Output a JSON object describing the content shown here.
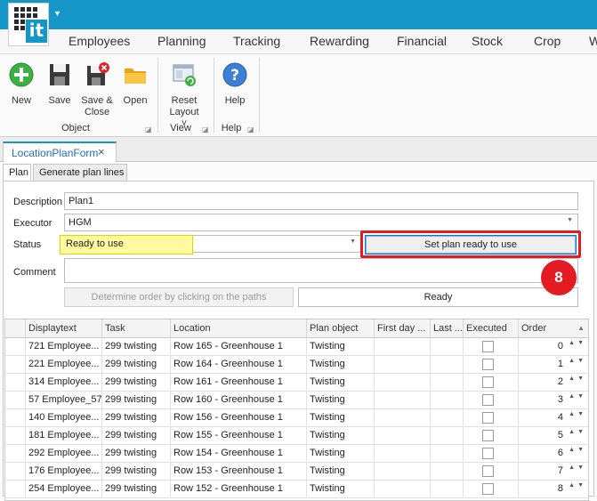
{
  "app": {
    "logo_text": "it",
    "quick_access_icon": "dropdown-arrow-icon",
    "brand_color": "#1496c8"
  },
  "menu": [
    "Employees",
    "Planning",
    "Tracking",
    "Rewarding",
    "Financial",
    "Stock",
    "Crop",
    "W"
  ],
  "ribbon": {
    "groups": [
      {
        "label": "Object",
        "buttons": [
          {
            "label": "New",
            "icon": "add-icon"
          },
          {
            "label": "Save",
            "icon": "save-icon"
          },
          {
            "label": "Save & Close",
            "icon": "save-close-icon"
          },
          {
            "label": "Open",
            "icon": "folder-icon"
          }
        ]
      },
      {
        "label": "View",
        "buttons": [
          {
            "label": "Reset Layout ˅",
            "icon": "reset-layout-icon"
          }
        ]
      },
      {
        "label": "Help",
        "buttons": [
          {
            "label": "Help",
            "icon": "help-icon"
          }
        ]
      }
    ]
  },
  "document_tab": {
    "label": "LocationPlanForm",
    "close": "×"
  },
  "subtabs": [
    "Plan",
    "Generate plan lines"
  ],
  "form": {
    "description_label": "Description",
    "description_value": "Plan1",
    "executor_label": "Executor",
    "executor_value": "HGM",
    "status_label": "Status",
    "status_value": "Ready to use",
    "comment_label": "Comment",
    "comment_value": "",
    "set_ready_button": "Set plan ready to use",
    "determine_order_button": "Determine order by clicking on the paths",
    "ready_button": "Ready",
    "step_badge": "8",
    "highlight_color": "#e31b23",
    "status_highlight_color": "#fff9a0"
  },
  "grid": {
    "columns": [
      "Displaytext",
      "Task",
      "Location",
      "Plan object",
      "First day ...",
      "Last ...",
      "Executed",
      "Order"
    ],
    "rows": [
      {
        "displaytext": "721 Employee...",
        "task": "299 twisting",
        "location": "Row 165 - Greenhouse 1",
        "plan_object": "Twisting",
        "first_day": "",
        "last": "",
        "executed": false,
        "order": "0"
      },
      {
        "displaytext": "221 Employee...",
        "task": "299 twisting",
        "location": "Row 164 - Greenhouse 1",
        "plan_object": "Twisting",
        "first_day": "",
        "last": "",
        "executed": false,
        "order": "1"
      },
      {
        "displaytext": "314 Employee...",
        "task": "299 twisting",
        "location": "Row 161 - Greenhouse 1",
        "plan_object": "Twisting",
        "first_day": "",
        "last": "",
        "executed": false,
        "order": "2"
      },
      {
        "displaytext": "57 Employee_57",
        "task": "299 twisting",
        "location": "Row 160 - Greenhouse 1",
        "plan_object": "Twisting",
        "first_day": "",
        "last": "",
        "executed": false,
        "order": "3"
      },
      {
        "displaytext": "140 Employee...",
        "task": "299 twisting",
        "location": "Row 156 - Greenhouse 1",
        "plan_object": "Twisting",
        "first_day": "",
        "last": "",
        "executed": false,
        "order": "4"
      },
      {
        "displaytext": "181 Employee...",
        "task": "299 twisting",
        "location": "Row 155 - Greenhouse 1",
        "plan_object": "Twisting",
        "first_day": "",
        "last": "",
        "executed": false,
        "order": "5"
      },
      {
        "displaytext": "292 Employee...",
        "task": "299 twisting",
        "location": "Row 154 - Greenhouse 1",
        "plan_object": "Twisting",
        "first_day": "",
        "last": "",
        "executed": false,
        "order": "6"
      },
      {
        "displaytext": "176 Employee...",
        "task": "299 twisting",
        "location": "Row 153 - Greenhouse 1",
        "plan_object": "Twisting",
        "first_day": "",
        "last": "",
        "executed": false,
        "order": "7"
      },
      {
        "displaytext": "254 Employee...",
        "task": "299 twisting",
        "location": "Row 152 - Greenhouse 1",
        "plan_object": "Twisting",
        "first_day": "",
        "last": "",
        "executed": false,
        "order": "8"
      }
    ]
  }
}
